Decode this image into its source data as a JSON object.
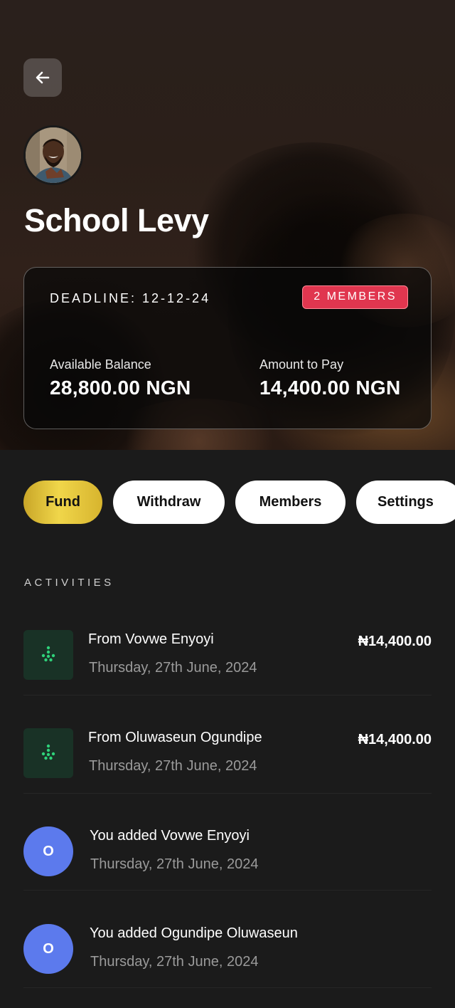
{
  "header": {
    "back_icon": "arrow-left-icon",
    "title": "School Levy"
  },
  "summary": {
    "deadline": "DEADLINE: 12-12-24",
    "members_badge": "2 MEMBERS",
    "available_label": "Available Balance",
    "available_value": "28,800.00 NGN",
    "to_pay_label": "Amount to Pay",
    "to_pay_value": "14,400.00 NGN"
  },
  "actions": {
    "fund": "Fund",
    "withdraw": "Withdraw",
    "members": "Members",
    "settings": "Settings"
  },
  "activities": {
    "label": "ACTIVITIES",
    "items": [
      {
        "title": "From Vovwe Enyoyi",
        "date": "Thursday, 27th June, 2024",
        "amount": "₦14,400.00",
        "icon": "transfer-dots-icon"
      },
      {
        "title": "From Oluwaseun Ogundipe",
        "date": "Thursday, 27th June, 2024",
        "amount": "₦14,400.00",
        "icon": "transfer-dots-icon"
      },
      {
        "title": "You added Vovwe Enyoyi",
        "date": "Thursday, 27th June, 2024",
        "initial": "O"
      },
      {
        "title": "You added Ogundipe Oluwaseun",
        "date": "Thursday, 27th June, 2024",
        "initial": "O"
      }
    ]
  },
  "colors": {
    "background": "#1b1b1b",
    "badge": "#e0364f",
    "fund_gold": "#e6c53c",
    "transfer_green": "#2fd27a",
    "member_circle": "#5c7aed"
  }
}
